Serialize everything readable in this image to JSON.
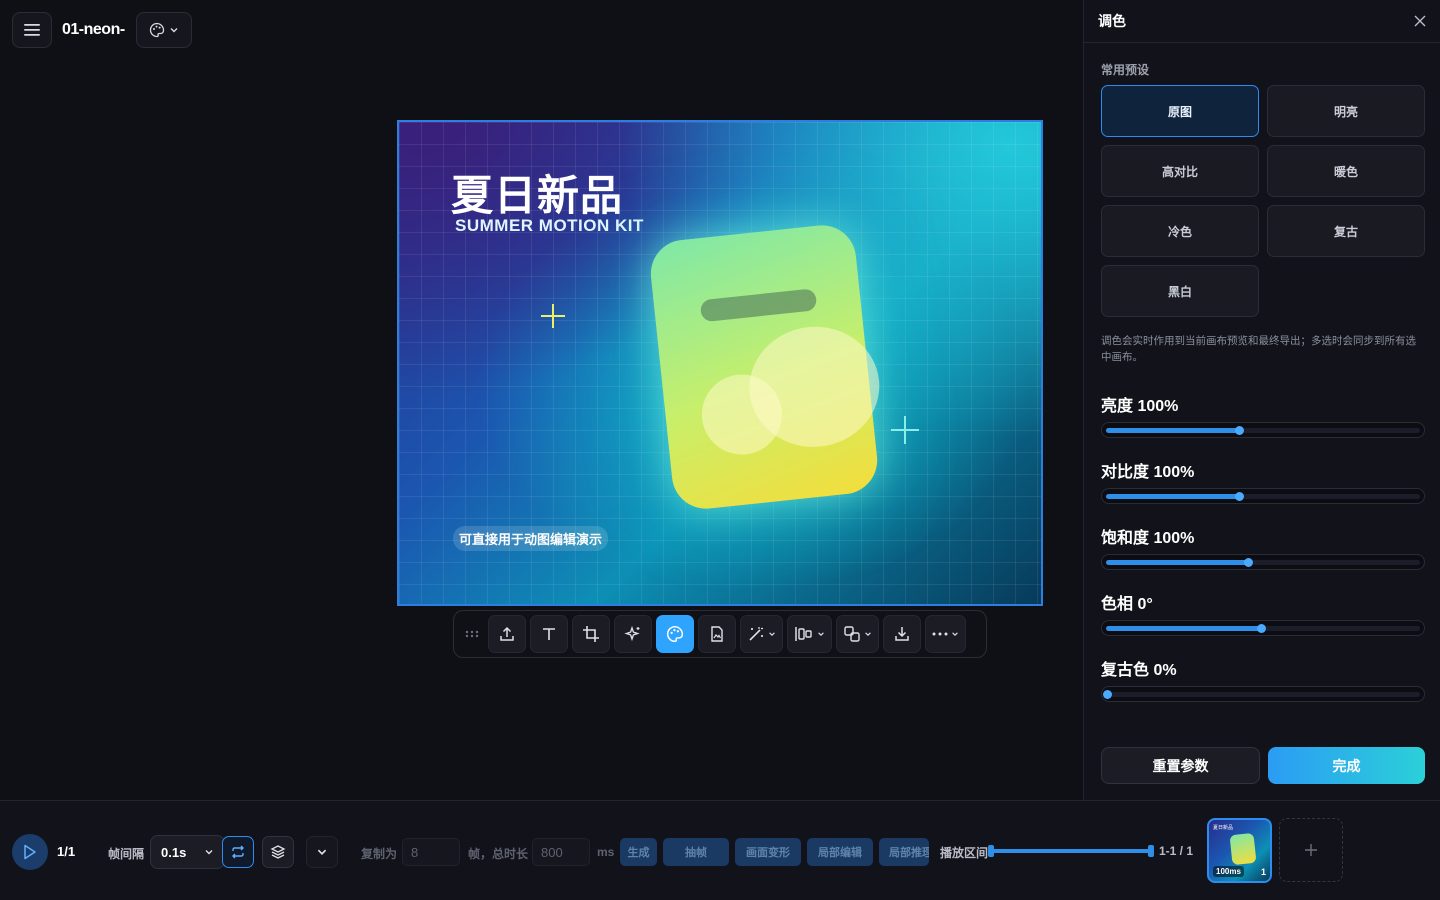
{
  "header": {
    "title": "01-neon-",
    "menu_icon": "hamburger-icon",
    "palette_icon": "palette-icon"
  },
  "canvas": {
    "title": "夏日新品",
    "subtitle": "SUMMER MOTION KIT",
    "tag": "可直接用于动图编辑演示"
  },
  "toolbar": {
    "items": [
      "drag-handle",
      "upload",
      "text",
      "crop",
      "sparkle",
      "palette",
      "image-edit",
      "magic-wand",
      "align",
      "transform",
      "download",
      "more"
    ],
    "active": "palette"
  },
  "panel": {
    "title": "调色",
    "preset_label": "常用预设",
    "presets": [
      "原图",
      "明亮",
      "高对比",
      "暖色",
      "冷色",
      "复古",
      "黑白"
    ],
    "selected_preset": "原图",
    "note": "调色会实时作用到当前画布预览和最终导出；多选时会同步到所有选中画布。",
    "sliders": [
      {
        "label": "亮度 100%",
        "value": 0.42
      },
      {
        "label": "对比度 100%",
        "value": 0.42
      },
      {
        "label": "饱和度 100%",
        "value": 0.45
      },
      {
        "label": "色相 0°",
        "value": 0.49
      },
      {
        "label": "复古色 0%",
        "value": 0.0
      }
    ],
    "reset_label": "重置参数",
    "done_label": "完成"
  },
  "bottom": {
    "frame_count": "1/1",
    "interval_label": "帧间隔",
    "interval_value": "0.1s",
    "copy_label": "复制为",
    "copy_value": "8",
    "total_label": "帧，总时长",
    "total_value": "800",
    "ms_label": "ms",
    "actions": [
      "生成",
      "抽帧",
      "画面变形",
      "局部编辑",
      "局部推理"
    ],
    "range_label": "播放区间",
    "range_value": "1-1 / 1",
    "thumb_duration": "100ms",
    "thumb_index": "1"
  },
  "colors": {
    "accent": "#2fa4ff",
    "selected_border": "#2c8cf0",
    "done_gradient_end": "#2bd0d8"
  }
}
